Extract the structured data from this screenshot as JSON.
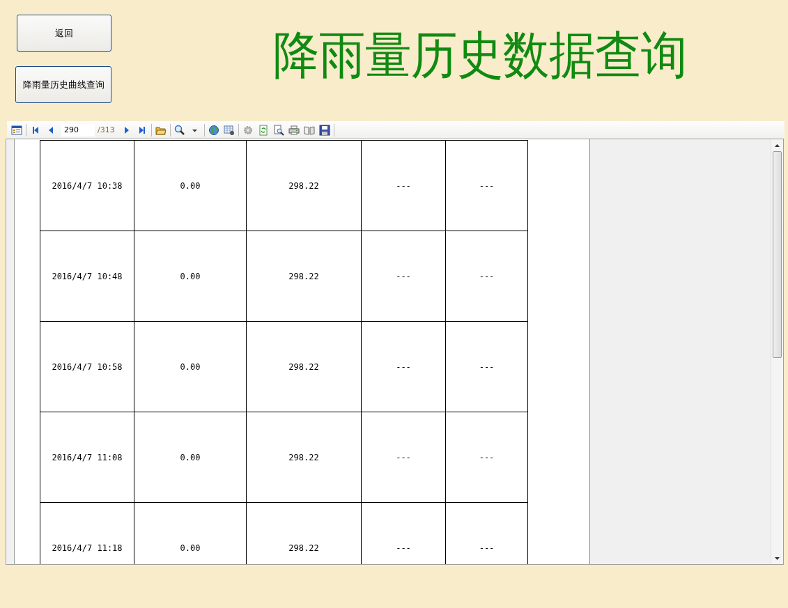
{
  "buttons": [
    {
      "label": "返回"
    },
    {
      "label": "降雨量历史曲线查询"
    }
  ],
  "title": "降雨量历史数据查询",
  "toolbar": {
    "page": "290",
    "page_total": "/313"
  },
  "table": {
    "rows": [
      {
        "cells": [
          "2016/4/7 10:38",
          "0.00",
          "298.22",
          "---",
          "---"
        ]
      },
      {
        "cells": [
          "2016/4/7 10:48",
          "0.00",
          "298.22",
          "---",
          "---"
        ]
      },
      {
        "cells": [
          "2016/4/7 10:58",
          "0.00",
          "298.22",
          "---",
          "---"
        ]
      },
      {
        "cells": [
          "2016/4/7 11:08",
          "0.00",
          "298.22",
          "---",
          "---"
        ]
      },
      {
        "cells": [
          "2016/4/7 11:18",
          "0.00",
          "298.22",
          "---",
          "---"
        ]
      }
    ]
  }
}
